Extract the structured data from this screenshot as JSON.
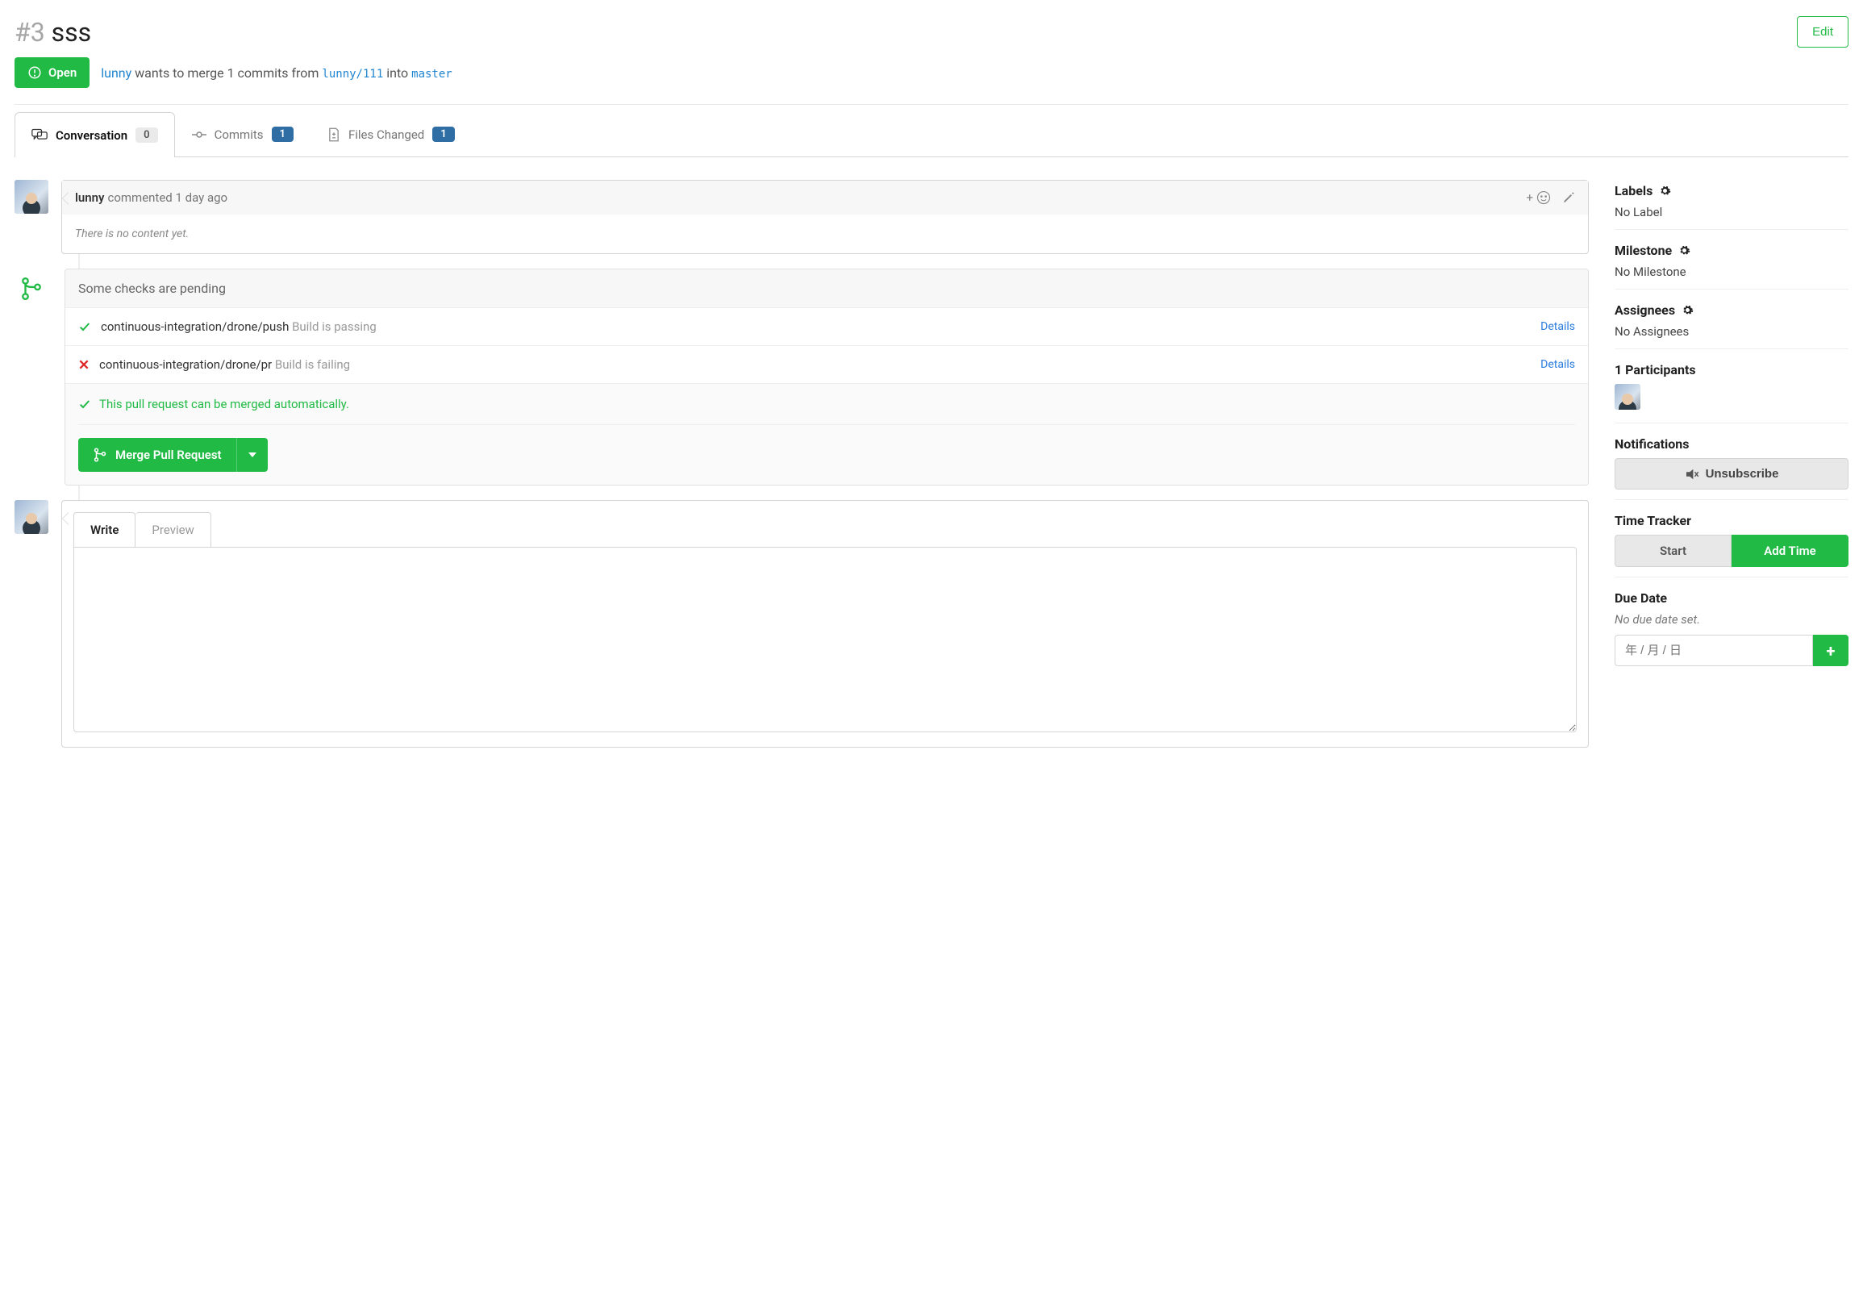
{
  "issue": {
    "number": "#3",
    "title": "sss",
    "edit": "Edit"
  },
  "state": {
    "label": "Open"
  },
  "mergeline": {
    "user": "lunny",
    "text1": "wants to merge 1 commits from",
    "from": "lunny/111",
    "into": "into",
    "to": "master"
  },
  "tabs": {
    "conversation": {
      "label": "Conversation",
      "count": "0"
    },
    "commits": {
      "label": "Commits",
      "count": "1"
    },
    "files": {
      "label": "Files Changed",
      "count": "1"
    }
  },
  "comment": {
    "author": "lunny",
    "action": "commented",
    "time": "1 day ago",
    "empty": "There is no content yet.",
    "plus": "+"
  },
  "checks": {
    "heading": "Some checks are pending",
    "items": [
      {
        "status": "pass",
        "name": "continuous-integration/drone/push",
        "detail": "Build is passing",
        "link": "Details"
      },
      {
        "status": "fail",
        "name": "continuous-integration/drone/pr",
        "detail": "Build is failing",
        "link": "Details"
      }
    ],
    "merge_ok": "This pull request can be merged automatically.",
    "merge_btn": "Merge Pull Request"
  },
  "editor": {
    "write": "Write",
    "preview": "Preview"
  },
  "sidebar": {
    "labels": {
      "title": "Labels",
      "value": "No Label"
    },
    "milestone": {
      "title": "Milestone",
      "value": "No Milestone"
    },
    "assignees": {
      "title": "Assignees",
      "value": "No Assignees"
    },
    "participants": {
      "title": "1 Participants"
    },
    "notifications": {
      "title": "Notifications",
      "btn": "Unsubscribe"
    },
    "time": {
      "title": "Time Tracker",
      "start": "Start",
      "add": "Add Time"
    },
    "due": {
      "title": "Due Date",
      "none": "No due date set.",
      "placeholder": "年 / 月 / 日",
      "plus": "+"
    }
  }
}
